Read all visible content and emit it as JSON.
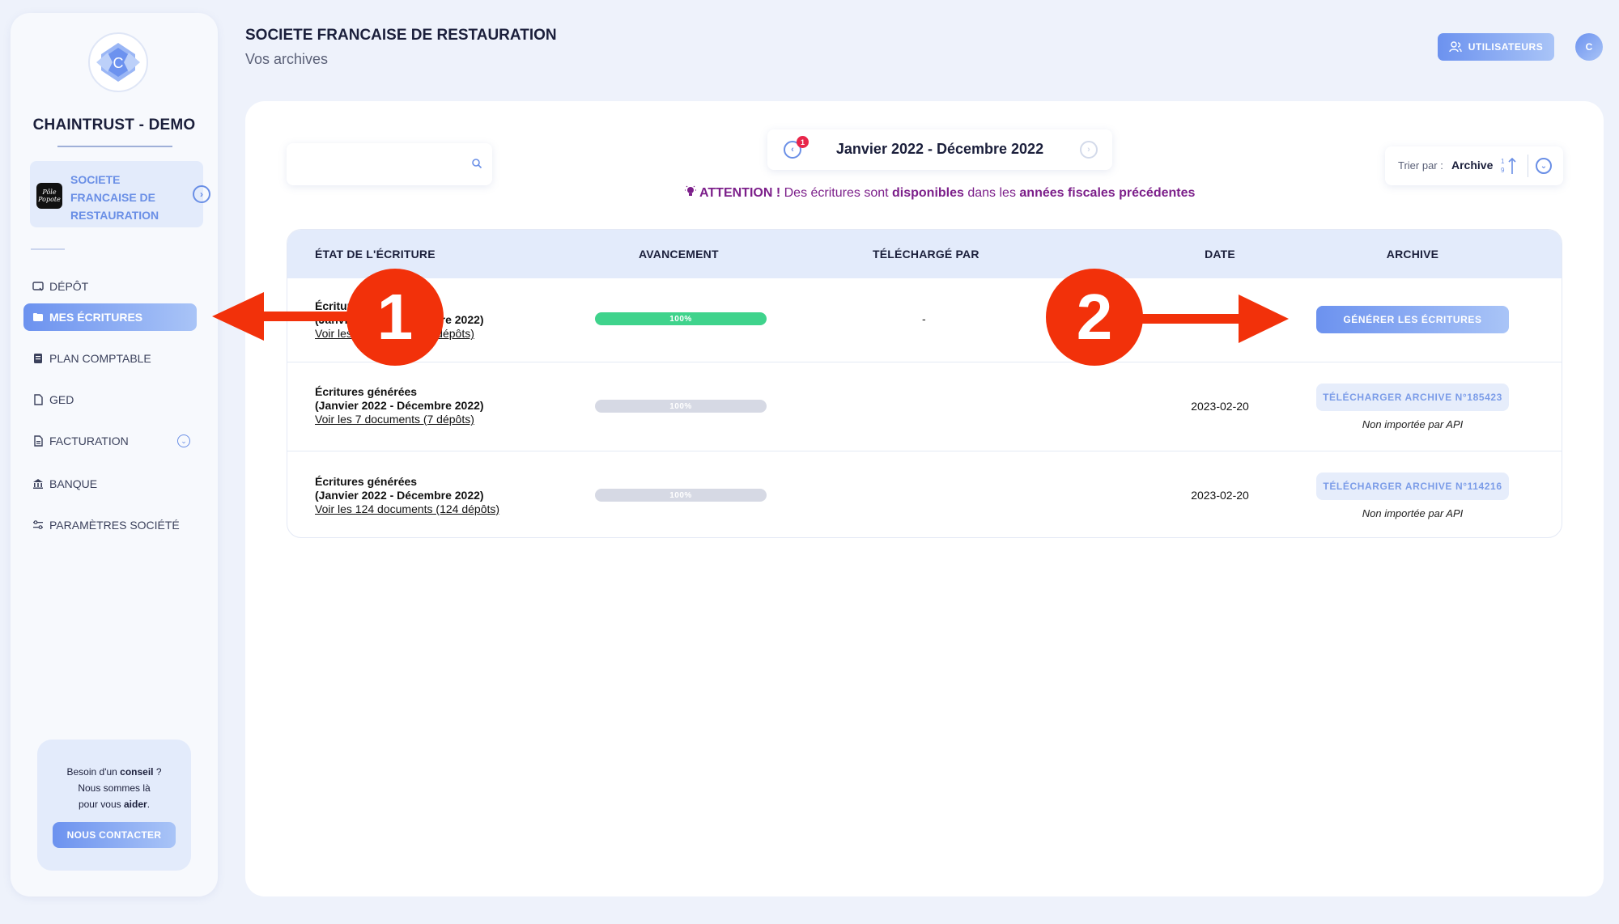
{
  "sidebar": {
    "brand": "CHAINTRUST - DEMO",
    "company": {
      "name": "SOCIETE FRANCAISE DE RESTAURATION",
      "logo_text": "Pôle Popote"
    },
    "nav": [
      {
        "label": "DÉPÔT",
        "icon": "upload-icon"
      },
      {
        "label": "MES ÉCRITURES",
        "icon": "folder-icon",
        "active": true
      },
      {
        "label": "PLAN COMPTABLE",
        "icon": "book-icon"
      },
      {
        "label": "GED",
        "icon": "document-icon"
      },
      {
        "label": "FACTURATION",
        "icon": "invoice-icon",
        "has_dropdown": true
      },
      {
        "label": "BANQUE",
        "icon": "bank-icon"
      },
      {
        "label": "PARAMÈTRES SOCIÉTÉ",
        "icon": "sliders-icon"
      }
    ],
    "help": {
      "line1_pre": "Besoin d'un ",
      "line1_b": "conseil",
      "line1_post": " ?",
      "line2": "Nous sommes là",
      "line3_pre": "pour vous ",
      "line3_b": "aider",
      "line3_post": ".",
      "button": "NOUS CONTACTER"
    }
  },
  "header": {
    "title": "SOCIETE FRANCAISE DE RESTAURATION",
    "subtitle": "Vos archives",
    "users_button": "UTILISATEURS",
    "avatar_initial": "C"
  },
  "toolbar": {
    "search_placeholder": "",
    "period": "Janvier 2022 - Décembre 2022",
    "period_badge": "1",
    "attention": {
      "prefix": "ATTENTION !",
      "t1": " Des écritures sont ",
      "b1": "disponibles",
      "t2": " dans les ",
      "b2": "années fiscales précédentes"
    },
    "sort_label": "Trier par :",
    "sort_value": "Archive"
  },
  "table": {
    "headers": [
      "ÉTAT DE L'ÉCRITURE",
      "AVANCEMENT",
      "TÉLÉCHARGÉ PAR",
      "DATE",
      "ARCHIVE"
    ],
    "rows": [
      {
        "title": "Écritures générées",
        "period": "(Janvier 2022 - Décembre 2022)",
        "link": "Voir les 3 documents (3 dépôts)",
        "progress": "100%",
        "uploaded_by": "-",
        "date": "",
        "action": "GÉNÉRER LES ÉCRITURES",
        "api_note": ""
      },
      {
        "title": "Écritures générées",
        "period": "(Janvier 2022 - Décembre 2022)",
        "link": "Voir les 7 documents (7 dépôts)",
        "progress": "100%",
        "uploaded_by": "",
        "date": "2023-02-20",
        "action": "TÉLÉCHARGER ARCHIVE N°185423",
        "api_note": "Non importée par API"
      },
      {
        "title": "Écritures générées",
        "period": "(Janvier 2022 - Décembre 2022)",
        "link": "Voir les 124 documents (124 dépôts)",
        "progress": "100%",
        "uploaded_by": "",
        "date": "2023-02-20",
        "action": "TÉLÉCHARGER ARCHIVE N°114216",
        "api_note": "Non importée par API"
      }
    ]
  },
  "annotations": {
    "marker1": "1",
    "marker2": "2",
    "color": "#f2310a"
  }
}
